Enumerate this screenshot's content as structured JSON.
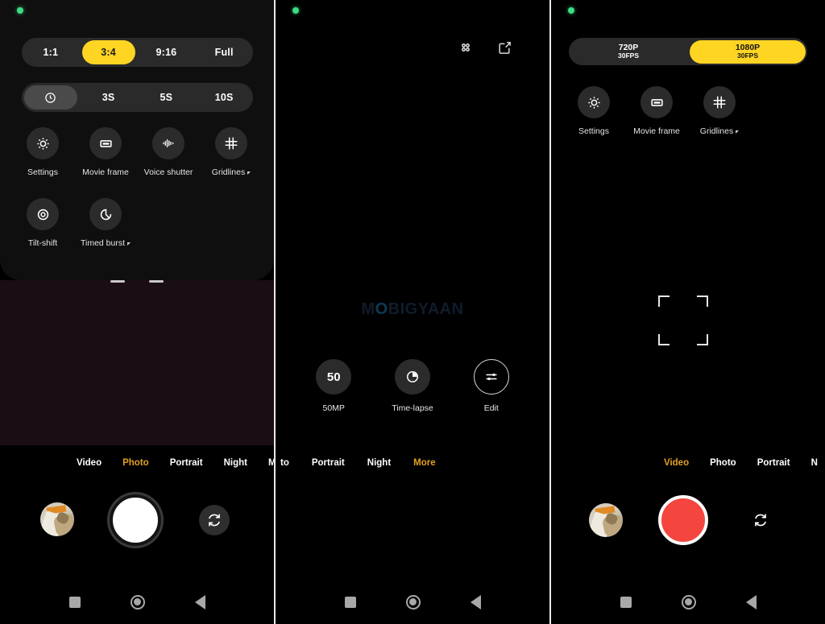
{
  "panel1": {
    "status_indicator": "green-privacy-dot",
    "aspect_ratios": [
      {
        "label": "1:1",
        "selected": false
      },
      {
        "label": "3:4",
        "selected": true
      },
      {
        "label": "9:16",
        "selected": false
      },
      {
        "label": "Full",
        "selected": false
      }
    ],
    "timer_options": [
      {
        "label": "",
        "icon": "timer-off-icon",
        "selected": true
      },
      {
        "label": "3S",
        "selected": false
      },
      {
        "label": "5S",
        "selected": false
      },
      {
        "label": "10S",
        "selected": false
      }
    ],
    "tiles": [
      {
        "label": "Settings",
        "icon": "gear-icon",
        "expandable": false
      },
      {
        "label": "Movie frame",
        "icon": "movie-frame-icon",
        "expandable": false
      },
      {
        "label": "Voice shutter",
        "icon": "voice-waveform-icon",
        "expandable": false
      },
      {
        "label": "Gridlines",
        "icon": "gridlines-icon",
        "expandable": true
      },
      {
        "label": "Tilt-shift",
        "icon": "tilt-shift-icon",
        "expandable": false
      },
      {
        "label": "Timed burst",
        "icon": "timed-burst-icon",
        "expandable": true
      }
    ],
    "modes": [
      {
        "label": "Video",
        "active": false
      },
      {
        "label": "Photo",
        "active": true
      },
      {
        "label": "Portrait",
        "active": false
      },
      {
        "label": "Night",
        "active": false
      },
      {
        "label": "M",
        "active": false
      }
    ],
    "controls": {
      "thumbnail": "gallery-thumbnail",
      "shutter": "photo-shutter-button",
      "flip": "flip-camera-icon"
    },
    "navbar": [
      {
        "icon": "recents-square-icon"
      },
      {
        "icon": "home-circle-icon"
      },
      {
        "icon": "back-triangle-icon"
      }
    ]
  },
  "panel2": {
    "status_indicator": "green-privacy-dot",
    "top_icons": [
      {
        "icon": "grid-dots-icon"
      },
      {
        "icon": "edit-square-icon"
      }
    ],
    "watermark": {
      "prefix": "M",
      "highlight": "O",
      "suffix": "BIGYAAN"
    },
    "options": [
      {
        "label": "50MP",
        "icon": "50",
        "style": "filled"
      },
      {
        "label": "Time-lapse",
        "icon": "time-lapse-icon",
        "style": "filled"
      },
      {
        "label": "Edit",
        "icon": "sliders-icon",
        "style": "outlined"
      }
    ],
    "modes": [
      {
        "label": "to",
        "active": false
      },
      {
        "label": "Portrait",
        "active": false
      },
      {
        "label": "Night",
        "active": false
      },
      {
        "label": "More",
        "active": true
      }
    ],
    "navbar": [
      {
        "icon": "recents-square-icon"
      },
      {
        "icon": "home-circle-icon"
      },
      {
        "icon": "back-triangle-icon"
      }
    ]
  },
  "panel3": {
    "status_indicator": "green-privacy-dot",
    "resolutions": [
      {
        "res": "720P",
        "fps": "30FPS",
        "selected": false
      },
      {
        "res": "1080P",
        "fps": "30FPS",
        "selected": true
      }
    ],
    "tiles": [
      {
        "label": "Settings",
        "icon": "gear-icon",
        "expandable": false
      },
      {
        "label": "Movie frame",
        "icon": "movie-frame-icon",
        "expandable": false
      },
      {
        "label": "Gridlines",
        "icon": "gridlines-icon",
        "expandable": true
      }
    ],
    "focus_frame": "focus-bracket",
    "modes": [
      {
        "label": "Video",
        "active": true
      },
      {
        "label": "Photo",
        "active": false
      },
      {
        "label": "Portrait",
        "active": false
      },
      {
        "label": "N",
        "active": false
      }
    ],
    "controls": {
      "thumbnail": "gallery-thumbnail",
      "shutter": "video-record-button",
      "flip": "flip-camera-icon"
    },
    "navbar": [
      {
        "icon": "recents-square-icon"
      },
      {
        "icon": "home-circle-icon"
      },
      {
        "icon": "back-triangle-icon"
      }
    ]
  },
  "colors": {
    "accent_yellow": "#ffd523",
    "mode_active": "#e2a024",
    "record_red": "#f4453f",
    "status_green": "#3ddc84",
    "sheet_bg": "#0f0f0f",
    "pill_bg": "#2a2a2a"
  }
}
